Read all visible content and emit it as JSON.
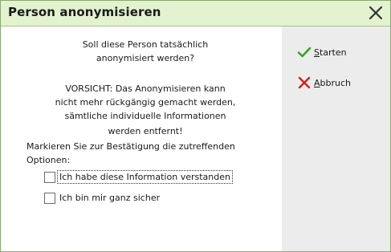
{
  "window": {
    "title": "Person anonymisieren"
  },
  "message": {
    "question_line1": "Soll diese Person tatsächlich",
    "question_line2": "anonymisiert werden?",
    "warning_line1": "VORSICHT: Das Anonymisieren kann",
    "warning_line2": "nicht mehr rückgängig gemacht werden,",
    "warning_line3": "sämtliche individuelle Informationen",
    "warning_line4": "werden entfernt!"
  },
  "confirmation": {
    "instruction_line1": "Markieren Sie zur Bestätigung die zutreffenden",
    "instruction_line2": "Optionen:",
    "options": [
      {
        "label": "Ich habe diese Information verstanden",
        "checked": false,
        "focused": true
      },
      {
        "label": "Ich bin mir ganz sicher",
        "checked": false,
        "focused": false
      }
    ]
  },
  "actions": {
    "start": {
      "accel": "S",
      "rest": "tarten",
      "icon": "checkmark-icon",
      "color": "#3aa02a"
    },
    "abort": {
      "accel": "A",
      "rest": "bbruch",
      "icon": "x-icon",
      "color": "#d42020"
    }
  },
  "colors": {
    "titlebar_bg": "#e3f2cf",
    "side_panel_bg": "#ececec"
  }
}
